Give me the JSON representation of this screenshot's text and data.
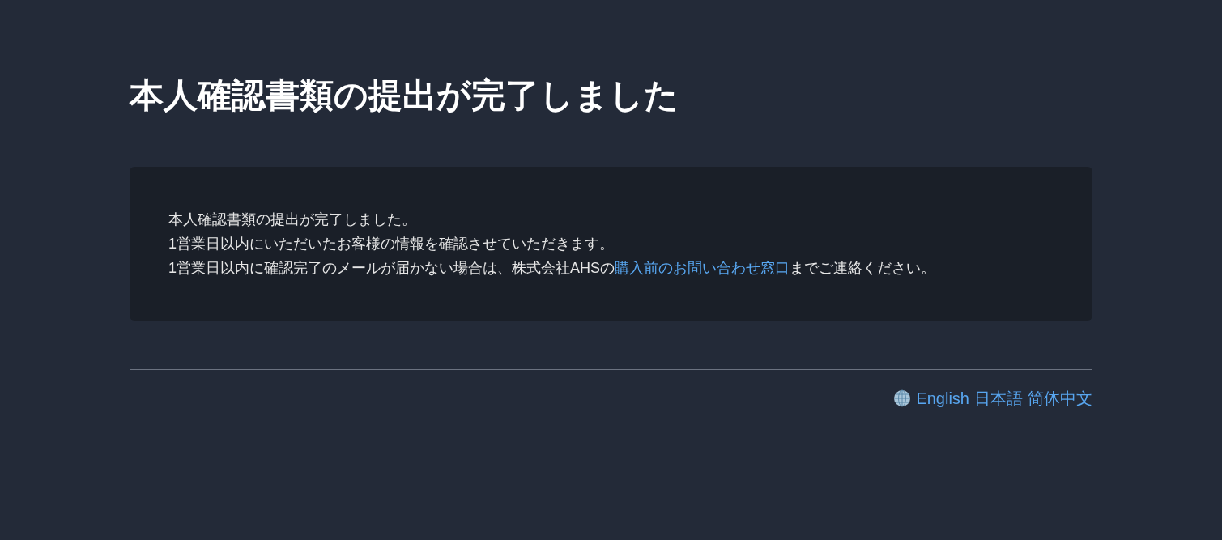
{
  "title": "本人確認書類の提出が完了しました",
  "message": {
    "lines": [
      "本人確認書類の提出が完了しました。",
      "1営業日以内にいただいたお客様の情報を確認させていただきます。"
    ],
    "contact": {
      "before": "1営業日以内に確認完了のメールが届かない場合は、株式会社AHSの",
      "link": "購入前のお問い合わせ窓口",
      "after": "までご連絡ください。"
    }
  },
  "languages": [
    {
      "label": "English"
    },
    {
      "label": "日本語"
    },
    {
      "label": "简体中文"
    }
  ]
}
